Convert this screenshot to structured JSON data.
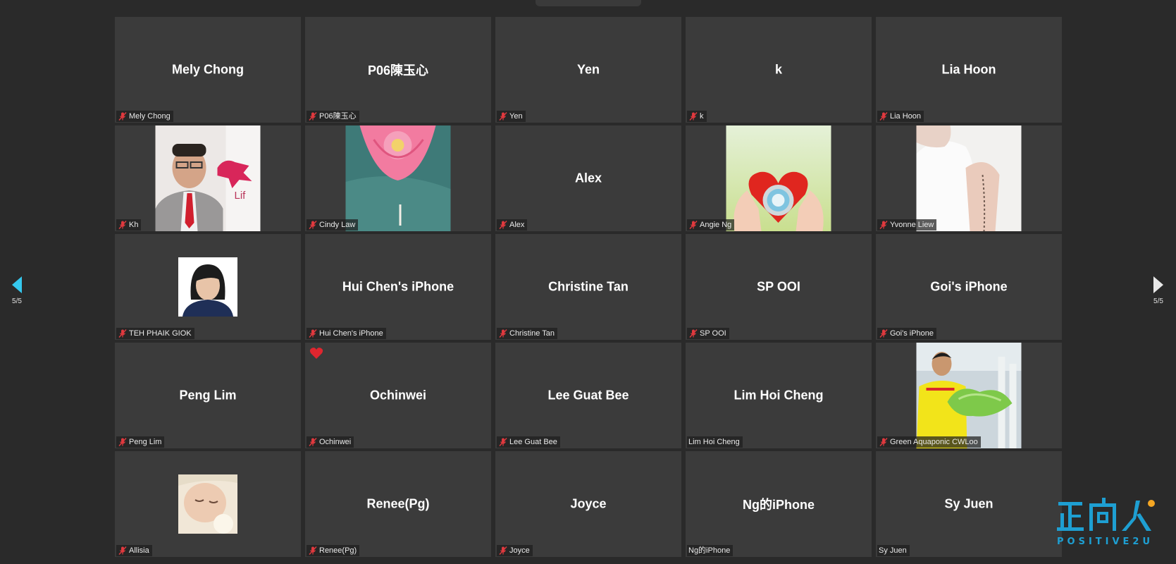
{
  "pager": {
    "left_label": "5/5",
    "right_label": "5/5"
  },
  "tiles": [
    {
      "center": "Mely Chong",
      "label": "Mely Chong",
      "muted": true
    },
    {
      "center": "P06陳玉心",
      "label": "P06陳玉心",
      "muted": true
    },
    {
      "center": "Yen",
      "label": "Yen",
      "muted": true
    },
    {
      "center": "k",
      "label": "k",
      "muted": true
    },
    {
      "center": "Lia Hoon",
      "label": "Lia Hoon",
      "muted": true
    },
    {
      "center": "",
      "label": "Kh",
      "muted": true,
      "photo": "man-with-lion-logo"
    },
    {
      "center": "",
      "label": "Cindy Law",
      "muted": true,
      "photo": "pink-lotus"
    },
    {
      "center": "Alex",
      "label": "Alex",
      "muted": true
    },
    {
      "center": "",
      "label": "Angie Ng",
      "muted": true,
      "photo": "hands-holding-heart"
    },
    {
      "center": "",
      "label": "Yvonne Liew",
      "muted": true,
      "photo": "woman-praying"
    },
    {
      "center": "",
      "label": "TEH PHAIK GIOK",
      "muted": true,
      "photo": "portrait-woman"
    },
    {
      "center": "Hui Chen's iPhone",
      "label": "Hui Chen's iPhone",
      "muted": true
    },
    {
      "center": "Christine Tan",
      "label": "Christine Tan",
      "muted": true
    },
    {
      "center": "SP OOI",
      "label": "SP OOI",
      "muted": true
    },
    {
      "center": "Goi's iPhone",
      "label": "Goi's iPhone",
      "muted": true
    },
    {
      "center": "Peng Lim",
      "label": "Peng Lim",
      "muted": true
    },
    {
      "center": "Ochinwei",
      "label": "Ochinwei",
      "muted": true,
      "reaction": "heart"
    },
    {
      "center": "Lee Guat Bee",
      "label": "Lee Guat Bee",
      "muted": true
    },
    {
      "center": "Lim Hoi Cheng",
      "label": "Lim Hoi Cheng",
      "muted": false
    },
    {
      "center": "",
      "label": "Green Aquaponic CWLoo",
      "muted": true,
      "photo": "man-with-lettuce"
    },
    {
      "center": "",
      "label": "Allisia",
      "muted": true,
      "photo": "sleeping-baby"
    },
    {
      "center": "Renee(Pg)",
      "label": "Renee(Pg)",
      "muted": true
    },
    {
      "center": "Joyce",
      "label": "Joyce",
      "muted": true
    },
    {
      "center": "Ng的iPhone",
      "label": "Ng的iPhone",
      "muted": false
    },
    {
      "center": "Sy Juen",
      "label": "Sy Juen",
      "muted": false
    }
  ],
  "watermark": {
    "cn": "正向人",
    "en": "POSITIVE2U"
  },
  "colors": {
    "accent": "#35c8ee",
    "mute_red": "#e0393e",
    "tile_bg": "#3b3b3b"
  }
}
